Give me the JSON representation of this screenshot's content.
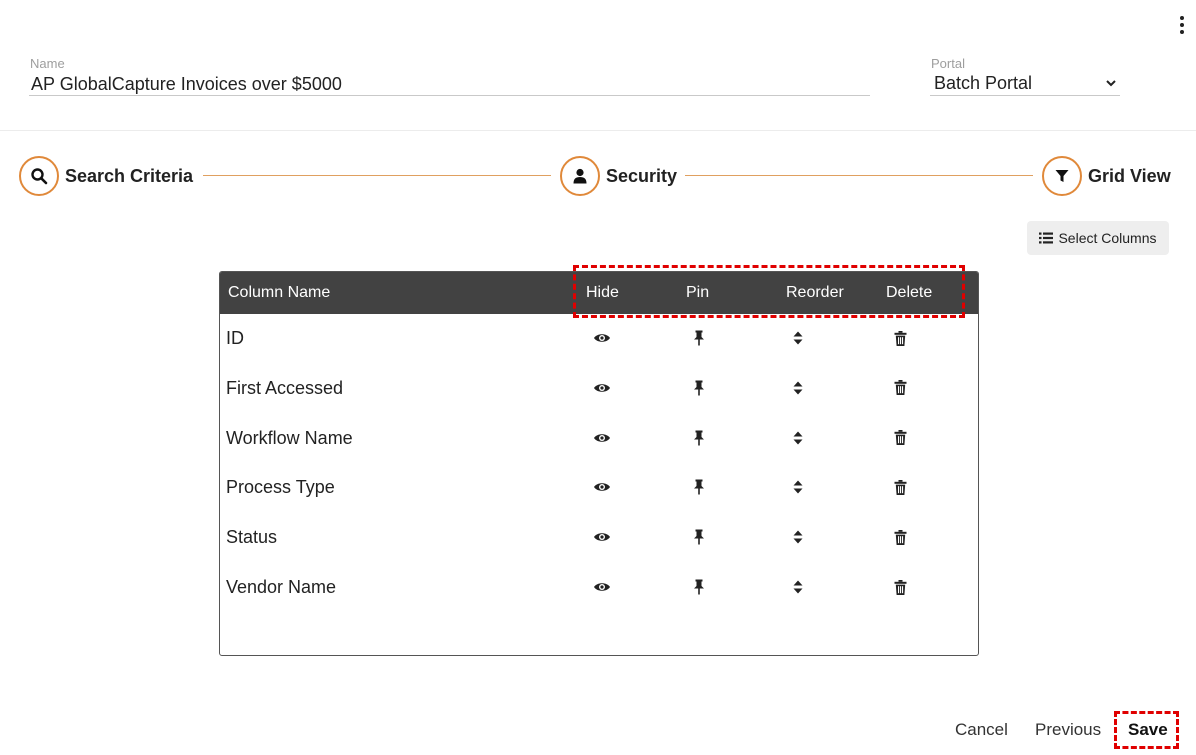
{
  "form": {
    "name_label": "Name",
    "name_value": "AP GlobalCapture Invoices over $5000",
    "portal_label": "Portal",
    "portal_value": "Batch Portal"
  },
  "steps": [
    {
      "label": "Search Criteria",
      "icon": "search-icon"
    },
    {
      "label": "Security",
      "icon": "user-icon"
    },
    {
      "label": "Grid View",
      "icon": "filter-icon"
    }
  ],
  "colors": {
    "accent": "#e0893a",
    "header_bg": "#424242",
    "highlight": "#e00000"
  },
  "select_columns_label": "Select Columns",
  "grid": {
    "headers": {
      "column_name": "Column Name",
      "hide": "Hide",
      "pin": "Pin",
      "reorder": "Reorder",
      "delete": "Delete"
    },
    "rows": [
      {
        "name": "ID"
      },
      {
        "name": "First Accessed"
      },
      {
        "name": "Workflow Name"
      },
      {
        "name": "Process Type"
      },
      {
        "name": "Status"
      },
      {
        "name": "Vendor Name"
      }
    ]
  },
  "footer": {
    "cancel": "Cancel",
    "previous": "Previous",
    "save": "Save"
  }
}
